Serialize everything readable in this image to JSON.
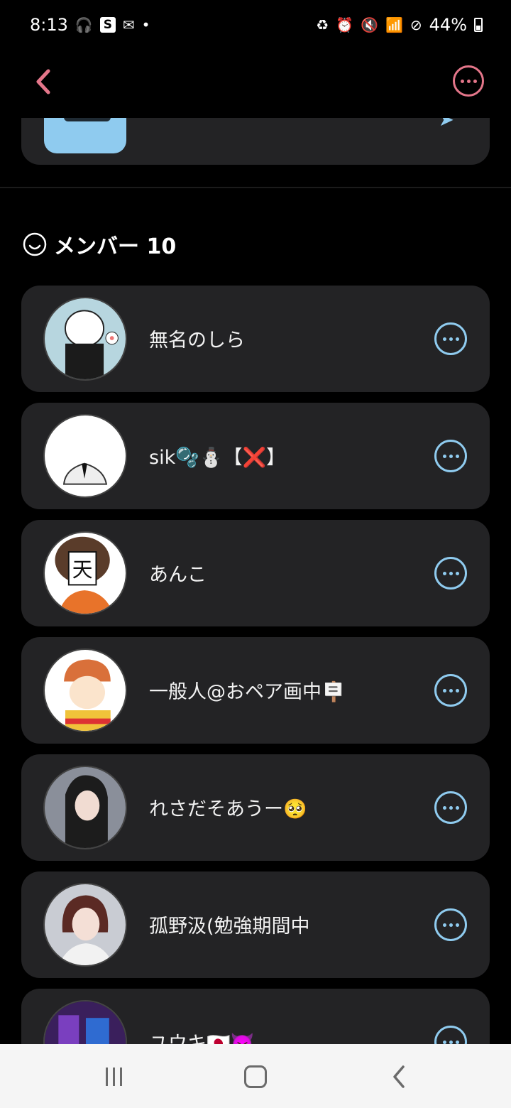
{
  "status_bar": {
    "time": "8:13",
    "left_icons": [
      "headset-icon",
      "s-app-icon",
      "mail-icon",
      "dot-icon"
    ],
    "right_icons": [
      "battery-saver-icon",
      "alarm-icon",
      "mute-icon",
      "wifi-icon",
      "dnd-icon"
    ],
    "battery": "44%",
    "s_label": "S"
  },
  "header": {
    "back_icon": "chevron-left-icon",
    "more_icon": "more-icon"
  },
  "members": {
    "title": "メンバー 10",
    "items": [
      {
        "name": "無名のしら"
      },
      {
        "name": "sik🫧⛄【❌】"
      },
      {
        "name": "あんこ"
      },
      {
        "name": "一般人@おペア画中🪧"
      },
      {
        "name": "れさだそあうー🥺"
      },
      {
        "name": "孤野汲(勉強期間中"
      },
      {
        "name": "ユウキ🇯🇵👿"
      }
    ]
  },
  "colors": {
    "accent_pink": "#e4768a",
    "accent_blue": "#8fcbef",
    "card_bg": "#232325"
  },
  "nav": {
    "recents": "recents-icon",
    "home": "home-icon",
    "back": "back-icon"
  }
}
